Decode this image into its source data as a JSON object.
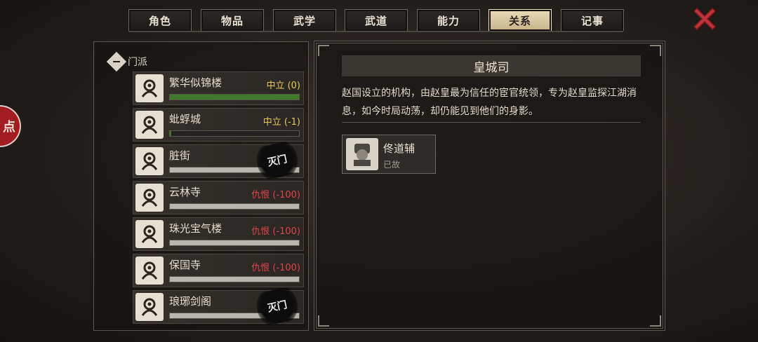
{
  "tabs": [
    {
      "label": "角色",
      "active": false
    },
    {
      "label": "物品",
      "active": false
    },
    {
      "label": "武学",
      "active": false
    },
    {
      "label": "武道",
      "active": false
    },
    {
      "label": "能力",
      "active": false
    },
    {
      "label": "关系",
      "active": true
    },
    {
      "label": "记事",
      "active": false
    }
  ],
  "side_button_label": "点",
  "close_icon": "close-x-icon",
  "group": {
    "label": "门派",
    "icon": "collapse-minus-icon"
  },
  "factions": [
    {
      "name": "繁华似锦楼",
      "status": "中立 (0)",
      "tone": "neutral",
      "bar_fill_pct": 100,
      "bar_style": "green",
      "extinct": false
    },
    {
      "name": "蚍蜉城",
      "status": "中立 (-1)",
      "tone": "neutral",
      "bar_fill_pct": 1,
      "bar_style": "green",
      "extinct": false
    },
    {
      "name": "脏街",
      "status": "",
      "tone": "neutral",
      "bar_fill_pct": 100,
      "bar_style": "grey",
      "extinct": true
    },
    {
      "name": "云林寺",
      "status": "仇恨 (-100)",
      "tone": "hate",
      "bar_fill_pct": 100,
      "bar_style": "grey",
      "extinct": false
    },
    {
      "name": "珠光宝气楼",
      "status": "仇恨 (-100)",
      "tone": "hate",
      "bar_fill_pct": 100,
      "bar_style": "grey",
      "extinct": false
    },
    {
      "name": "保国寺",
      "status": "仇恨 (-100)",
      "tone": "hate",
      "bar_fill_pct": 100,
      "bar_style": "grey",
      "extinct": false
    },
    {
      "name": "琅琊剑阁",
      "status": "",
      "tone": "neutral",
      "bar_fill_pct": 100,
      "bar_style": "grey",
      "extinct": true
    }
  ],
  "extinct_seal_text": "灭门",
  "detail": {
    "title": "皇城司",
    "description": "赵国设立的机构，由赵皇最为信任的宦官统领，专为赵皇监探江湖消息，如今时局动荡，却仍能见到他们的身影。",
    "members": [
      {
        "name": "佟道辅",
        "status": "已故"
      }
    ]
  },
  "colors": {
    "accent_tab": "#e9dcb9",
    "neutral": "#e6c85a",
    "hate": "#e0434a",
    "bar_green": "#3f7a2c",
    "close": "#c0323a"
  }
}
